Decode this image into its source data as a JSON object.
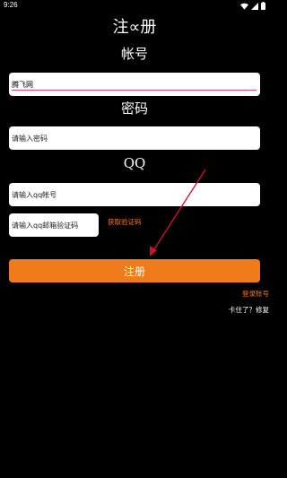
{
  "status_bar": {
    "time": "9:26",
    "icons": [
      "wifi-icon",
      "signal-icon",
      "battery-icon"
    ]
  },
  "app": {
    "title": "注∝册"
  },
  "account": {
    "label": "帐号",
    "value": "腾飞网"
  },
  "password": {
    "label": "密码",
    "placeholder": "请输入密码"
  },
  "qq": {
    "label": "QQ",
    "placeholder": "请输入qq帐号"
  },
  "code": {
    "placeholder": "请输入qq邮箱验证码",
    "get_code_label": "获取验证码"
  },
  "register_button": {
    "label": "注册"
  },
  "links": {
    "login": "登录账号",
    "stuck": "卡住了？修复"
  },
  "colors": {
    "accent": "#f07b1a",
    "background": "#000000",
    "field": "#ffffff",
    "arrow": "#d0102a",
    "underline": "#e0408a"
  }
}
